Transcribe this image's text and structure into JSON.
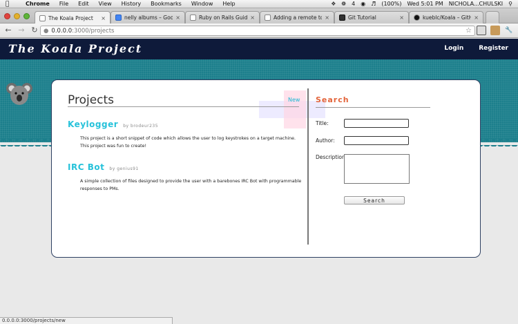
{
  "menubar": {
    "app": "Chrome",
    "items": [
      "File",
      "Edit",
      "View",
      "History",
      "Bookmarks",
      "Window",
      "Help"
    ],
    "battery": "(100%)",
    "clock": "Wed 5:01 PM",
    "user": "NICHOLA...CHULSKI",
    "wifi_count": "4"
  },
  "tabs": [
    {
      "label": "The Koala Project",
      "active": true
    },
    {
      "label": "nelly albums – Google Sear",
      "active": false
    },
    {
      "label": "Ruby on Rails Guides: Rails",
      "active": false
    },
    {
      "label": "Adding a remote to existing",
      "active": false
    },
    {
      "label": "Git Tutorial",
      "active": false
    },
    {
      "label": "kueblc/Koala – GitHub",
      "active": false
    }
  ],
  "address": {
    "host": "0.0.0.0",
    "path": ":3000/projects"
  },
  "site": {
    "brand": "The Koala Project",
    "nav": {
      "login": "Login",
      "register": "Register"
    }
  },
  "projects_section": {
    "title": "Projects",
    "new_label": "New",
    "items": [
      {
        "title": "Keylogger",
        "by": "by brodeur235",
        "description": "This project is a short snippet of code which allows the user to log keystrokes on a target machine. This project was fun to create!"
      },
      {
        "title": "IRC Bot",
        "by": "by genius91",
        "description": "A simple collection of files designed to provide the user with a barebones IRC Bot with programmable responses to PMs."
      }
    ]
  },
  "search_section": {
    "title": "Search",
    "title_label": "Title:",
    "author_label": "Author:",
    "description_label": "Description:",
    "button": "Search"
  },
  "status_url": "0.0.0.0:3000/projects/new",
  "colors": {
    "header_bg": "#0e1a3a",
    "teal": "#1c7f8c",
    "project_title": "#27c2da",
    "search_title": "#e3643a"
  }
}
